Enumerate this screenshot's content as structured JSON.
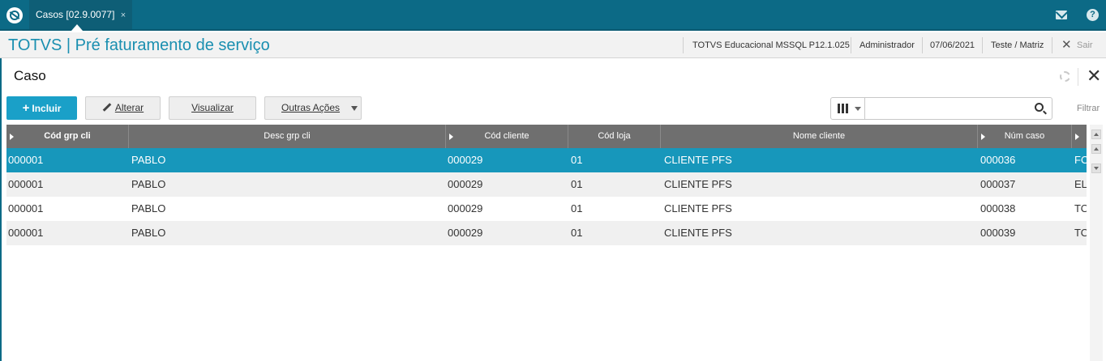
{
  "topbar": {
    "tab_label": "Casos [02.9.0077]",
    "tab_close": "×",
    "help": "?"
  },
  "titlebar": {
    "title": "TOTVS | Pré faturamento de serviço",
    "environment": "TOTVS Educacional MSSQL P12.1.025",
    "user": "Administrador",
    "date": "07/06/2021",
    "branch": "Teste / Matriz",
    "close": "✕",
    "exit_label": "Sair"
  },
  "page": {
    "title": "Caso",
    "close": "✕"
  },
  "toolbar": {
    "incluir": "Incluir",
    "incluir_plus": "+",
    "alterar": "Alterar",
    "visualizar": "Visualizar",
    "outras_acoes": "Outras Ações",
    "search_placeholder": "",
    "filtrar": "Filtrar"
  },
  "grid": {
    "columns": [
      "Cód grp cli",
      "Desc grp cli",
      "Cód cliente",
      "Cód loja",
      "Nome cliente",
      "Núm caso",
      ""
    ],
    "rows": [
      [
        "000001",
        "PABLO",
        "000029",
        "01",
        "CLIENTE PFS",
        "000036",
        "FO"
      ],
      [
        "000001",
        "PABLO",
        "000029",
        "01",
        "CLIENTE PFS",
        "000037",
        "ELI"
      ],
      [
        "000001",
        "PABLO",
        "000029",
        "01",
        "CLIENTE PFS",
        "000038",
        "TO"
      ],
      [
        "000001",
        "PABLO",
        "000029",
        "01",
        "CLIENTE PFS",
        "000039",
        "TO"
      ]
    ],
    "selected_row": 0
  },
  "colors": {
    "topbar": "#0c6a86",
    "accent": "#1a8fb0",
    "primary_button": "#1aa0c8",
    "selected_row": "#1797bb",
    "grid_header": "#6f6f6f"
  }
}
